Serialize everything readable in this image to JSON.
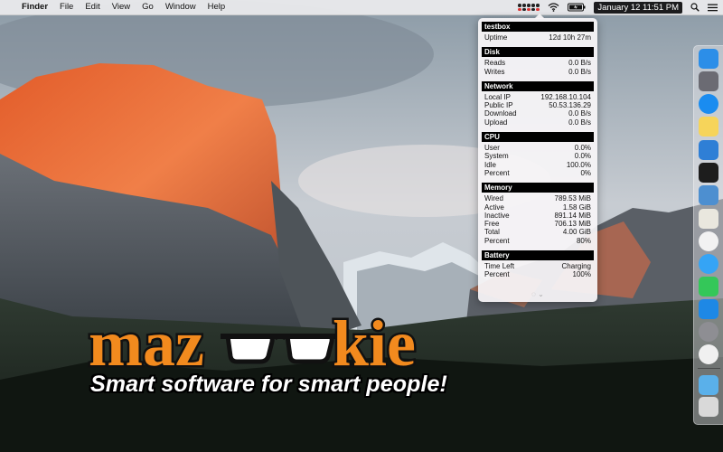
{
  "menubar": {
    "apple_glyph": "",
    "app_name": "Finder",
    "menus": [
      "File",
      "Edit",
      "View",
      "Go",
      "Window",
      "Help"
    ],
    "clock": "January 12  11:51 PM",
    "status_icons": [
      "mazookie-status-icon",
      "wifi-icon",
      "battery-icon",
      "search-icon",
      "list-icon"
    ]
  },
  "panel": {
    "sections": [
      {
        "title": "testbox",
        "rows": [
          {
            "label": "Uptime",
            "value": "12d 10h 27m"
          }
        ]
      },
      {
        "title": "Disk",
        "rows": [
          {
            "label": "Reads",
            "value": "0.0 B/s"
          },
          {
            "label": "Writes",
            "value": "0.0 B/s"
          }
        ]
      },
      {
        "title": "Network",
        "rows": [
          {
            "label": "Local IP",
            "value": "192.168.10.104"
          },
          {
            "label": "Public IP",
            "value": "50.53.136.29"
          },
          {
            "label": "Download",
            "value": "0.0 B/s"
          },
          {
            "label": "Upload",
            "value": "0.0 B/s"
          }
        ]
      },
      {
        "title": "CPU",
        "rows": [
          {
            "label": "User",
            "value": "0.0%"
          },
          {
            "label": "System",
            "value": "0.0%"
          },
          {
            "label": "Idle",
            "value": "100.0%"
          },
          {
            "label": "Percent",
            "value": "0%"
          }
        ]
      },
      {
        "title": "Memory",
        "rows": [
          {
            "label": "Wired",
            "value": "789.53 MiB"
          },
          {
            "label": "Active",
            "value": "1.58 GiB"
          },
          {
            "label": "Inactive",
            "value": "891.14 MiB"
          },
          {
            "label": "Free",
            "value": "706.13 MiB"
          },
          {
            "label": "Total",
            "value": "4.00 GiB"
          },
          {
            "label": "Percent",
            "value": "80%"
          }
        ]
      },
      {
        "title": "Battery",
        "rows": [
          {
            "label": "Time Left",
            "value": "Charging"
          },
          {
            "label": "Percent",
            "value": "100%"
          }
        ]
      }
    ],
    "footer_glyph": "◌ ⌄"
  },
  "dock": {
    "items": [
      {
        "name": "finder-icon",
        "color": "#2c8ee8"
      },
      {
        "name": "launchpad-icon",
        "color": "#6b6b73"
      },
      {
        "name": "safari-icon",
        "color": "#1a8cf0"
      },
      {
        "name": "notes-icon",
        "color": "#f6d45a"
      },
      {
        "name": "xcode-icon",
        "color": "#2f7fd6"
      },
      {
        "name": "terminal-icon",
        "color": "#1d1d1d"
      },
      {
        "name": "preview-icon",
        "color": "#4d8fd0"
      },
      {
        "name": "textedit-icon",
        "color": "#e9e7de"
      },
      {
        "name": "photos-icon",
        "color": "#f2f2f2"
      },
      {
        "name": "messages-icon",
        "color": "#35a4f5"
      },
      {
        "name": "facetime-icon",
        "color": "#34c759"
      },
      {
        "name": "app-store-icon",
        "color": "#1e88e5"
      },
      {
        "name": "system-preferences-icon",
        "color": "#8e8e93"
      },
      {
        "name": "clock-icon",
        "color": "#f0f0f0"
      },
      {
        "name": "downloads-folder-icon",
        "color": "#5ab0ea"
      },
      {
        "name": "trash-icon",
        "color": "#d9d9d9"
      }
    ]
  },
  "logo": {
    "word_left": "maz",
    "word_right": "kie",
    "tagline": "Smart software for smart people!",
    "color_orange": "#f28a1e",
    "color_black": "#111111"
  }
}
